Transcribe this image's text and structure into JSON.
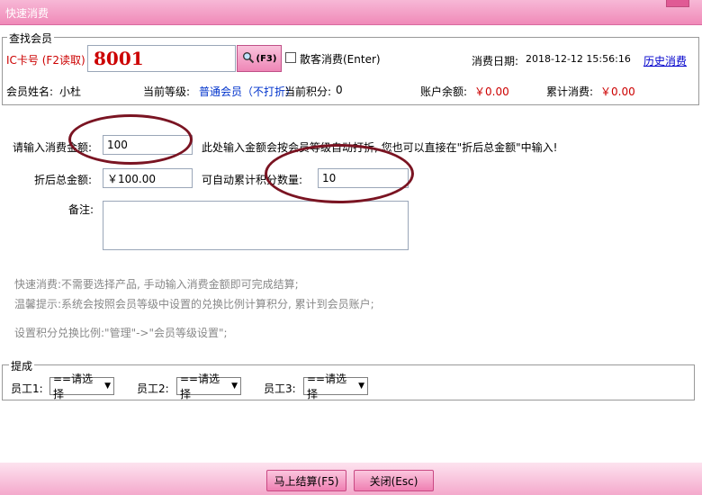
{
  "window": {
    "title": "快速消费"
  },
  "member_lookup": {
    "legend": "查找会员",
    "card_label": "IC卡号 (F2读取)",
    "card_value": "8001",
    "search_button_label": "(F3)",
    "walk_in_label": "散客消费(Enter)",
    "date_label": "消费日期:",
    "date_value": "2018-12-12 15:56:16",
    "history_link": "历史消费",
    "name_label": "会员姓名:",
    "name_value": "小杜",
    "level_label": "当前等级:",
    "level_value": "普通会员（不打折）",
    "points_label": "当前积分:",
    "points_value": "0",
    "balance_label": "账户余额:",
    "balance_value": "￥0.00",
    "total_label": "累计消费:",
    "total_value": "￥0.00"
  },
  "form": {
    "amount_label": "请输入消费金额:",
    "amount_value": "100",
    "amount_hint": "此处输入金额会按会员等级自动打折, 您也可以直接在\"折后总金额\"中输入!",
    "discounted_label": "折后总金额:",
    "discounted_value": "￥100.00",
    "points_label": "可自动累计积分数量:",
    "points_value": "10",
    "remark_label": "备注:",
    "remark_value": ""
  },
  "hints": {
    "line1": "快速消费:不需要选择产品, 手动输入消费金额即可完成结算;",
    "line2": "温馨提示:系统会按照会员等级中设置的兑换比例计算积分, 累计到会员账户;",
    "line3": "设置积分兑换比例:\"管理\"->\"会员等级设置\";"
  },
  "commission": {
    "legend": "提成",
    "staff1_label": "员工1:",
    "staff2_label": "员工2:",
    "staff3_label": "员工3:",
    "select_placeholder": "==请选择"
  },
  "footer": {
    "settle_button": "马上结算(F5)",
    "close_button": "关闭(Esc)"
  },
  "colors": {
    "accent_pink": "#f08ab8",
    "money_red": "#cc0000",
    "level_blue": "#0033cc",
    "annotation_circle": "#7a1422"
  }
}
